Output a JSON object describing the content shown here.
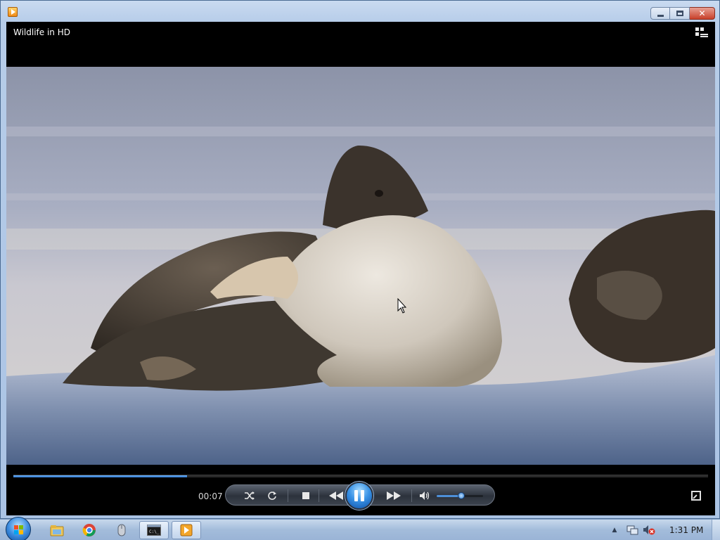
{
  "window": {
    "app_icon": "media-player-icon",
    "controls": [
      "minimize-icon",
      "maximize-icon",
      "close-icon"
    ]
  },
  "player": {
    "title": "Wildlife in HD",
    "switch_to_library_icon": "switch-to-library-icon",
    "elapsed_time": "00:07",
    "seek_progress": 0.25,
    "volume_level": 0.53,
    "state": "playing"
  },
  "controls": {
    "icons": [
      "shuffle-icon",
      "repeat-icon",
      "stop-icon",
      "previous-icon",
      "pause-icon",
      "next-icon",
      "volume-icon",
      "fullscreen-icon"
    ]
  },
  "taskbar": {
    "pinned": [
      "start-orb-icon",
      "explorer-icon",
      "chrome-icon",
      "mouse-icon",
      "cmd-icon",
      "media-player-icon"
    ],
    "tray_icons": [
      "show-hidden-icons",
      "network-icon",
      "volume-muted-icon"
    ],
    "clock": "1:31 PM"
  },
  "colors": {
    "window_frame": "#b7cde9",
    "player_bg": "#000000",
    "accent_blue": "#2a6fc4",
    "close_red": "#c8402a"
  }
}
